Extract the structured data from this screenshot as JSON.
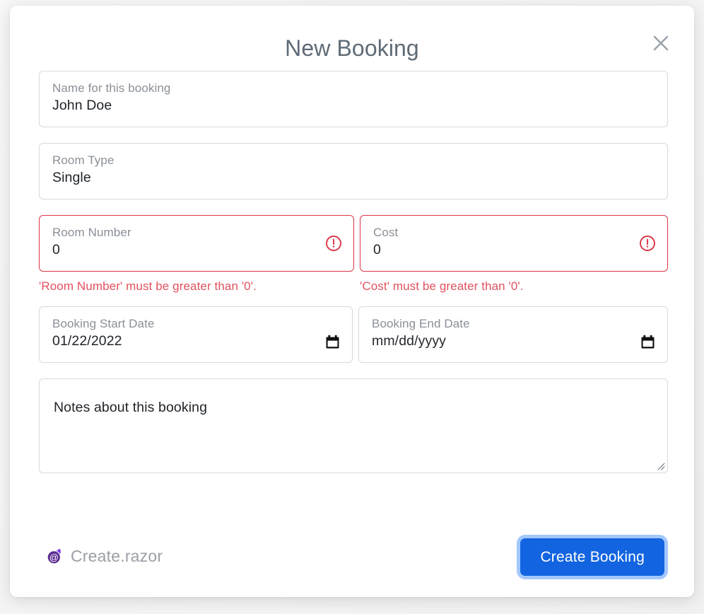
{
  "dialog": {
    "title": "New Booking",
    "close_icon": "close-x-icon"
  },
  "fields": {
    "name": {
      "label": "Name for this booking",
      "value": "John Doe"
    },
    "room_type": {
      "label": "Room Type",
      "value": "Single"
    },
    "room_number": {
      "label": "Room Number",
      "value": "0",
      "error": "'Room Number' must be greater than '0'.",
      "error_icon": "exclamation-circle-icon"
    },
    "cost": {
      "label": "Cost",
      "value": "0",
      "error": "'Cost' must be greater than '0'.",
      "error_icon": "exclamation-circle-icon"
    },
    "start_date": {
      "label": "Booking Start Date",
      "value": "01/22/2022",
      "icon": "calendar-icon"
    },
    "end_date": {
      "label": "Booking End Date",
      "value": "mm/dd/yyyy",
      "icon": "calendar-icon"
    },
    "notes": {
      "placeholder": "Notes about this booking",
      "value": "Notes about this booking"
    }
  },
  "footer": {
    "source_file": "Create.razor",
    "source_icon": "blazor-logo-icon",
    "submit_label": "Create Booking"
  },
  "colors": {
    "accent": "#1264e0",
    "error": "#dc3545",
    "error_text": "#e2515f",
    "label": "#8a9097",
    "title": "#5f6b76",
    "border": "#d5dade",
    "blazor_purple": "#5c2d91"
  }
}
